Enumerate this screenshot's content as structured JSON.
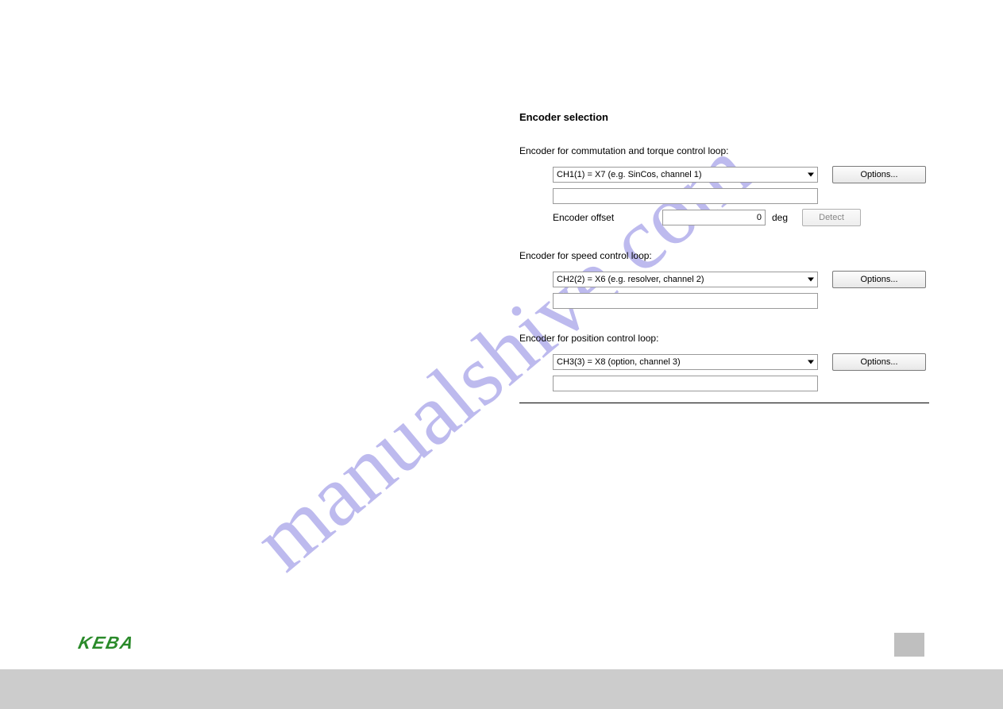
{
  "watermark": "manualshive.com",
  "title": "Encoder selection",
  "commutation": {
    "label": "Encoder for commutation and torque control loop:",
    "select": "CH1(1) = X7 (e.g. SinCos, channel 1)",
    "options_btn": "Options...",
    "offset_label": "Encoder offset",
    "offset_value": "0",
    "offset_unit": "deg",
    "detect_btn": "Detect"
  },
  "speed": {
    "label": "Encoder for speed control loop:",
    "select": "CH2(2) = X6 (e.g. resolver, channel 2)",
    "options_btn": "Options..."
  },
  "position": {
    "label": "Encoder for position control loop:",
    "select": "CH3(3) = X8 (option, channel 3)",
    "options_btn": "Options..."
  },
  "logo": "KEBA"
}
